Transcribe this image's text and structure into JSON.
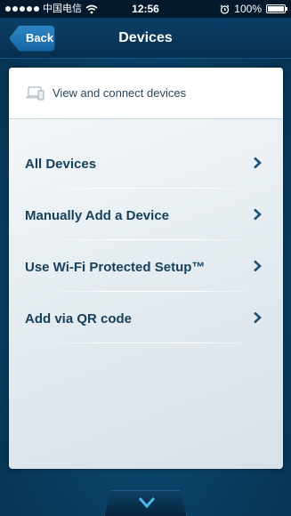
{
  "status_bar": {
    "carrier": "中国电信",
    "time": "12:56",
    "battery": "100%"
  },
  "nav": {
    "back_label": "Back",
    "title": "Devices"
  },
  "card": {
    "header_text": "View and connect devices",
    "items": [
      {
        "label": "All Devices"
      },
      {
        "label": "Manually Add a Device"
      },
      {
        "label": "Use Wi-Fi Protected Setup™"
      },
      {
        "label": "Add via QR code"
      }
    ]
  },
  "colors": {
    "accent": "#1565a3",
    "item_text": "#17405c"
  }
}
